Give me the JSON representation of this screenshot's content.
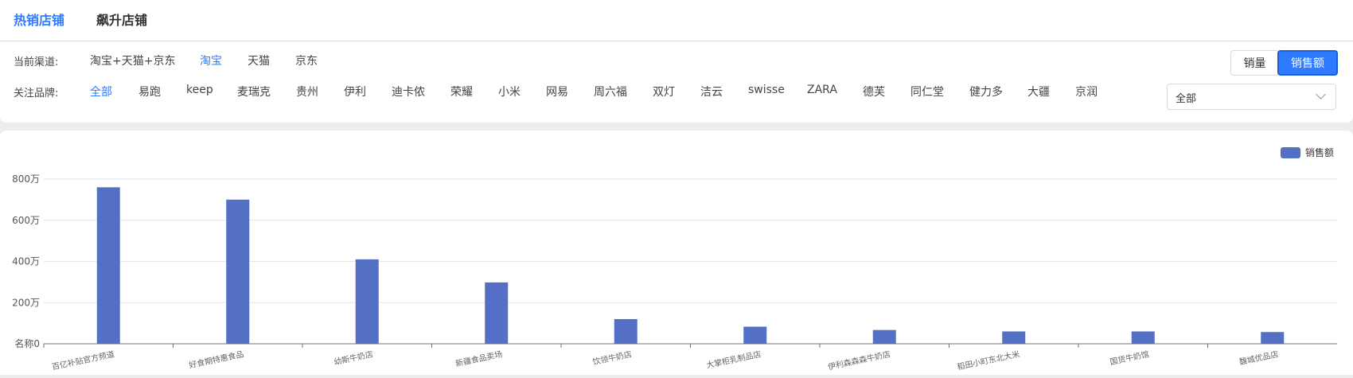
{
  "tabs": [
    {
      "label": "热销店铺",
      "active": true
    },
    {
      "label": "飙升店铺",
      "active": false
    }
  ],
  "channel": {
    "label": "当前渠道:",
    "options": [
      "淘宝+天猫+京东",
      "淘宝",
      "天猫",
      "京东"
    ],
    "selected": "淘宝"
  },
  "brand": {
    "label": "关注品牌:",
    "options": [
      "全部",
      "易跑",
      "keep",
      "麦瑞克",
      "贵州",
      "伊利",
      "迪卡侬",
      "荣耀",
      "小米",
      "网易",
      "周六福",
      "双灯",
      "洁云",
      "swisse",
      "ZARA",
      "德芙",
      "同仁堂",
      "健力多",
      "大疆",
      "京润"
    ],
    "selected": "全部"
  },
  "metric_toggle": {
    "options": [
      "销量",
      "销售额"
    ],
    "selected": "销售额"
  },
  "dropdown": {
    "value": "全部"
  },
  "colors": {
    "accent": "#2f7bff",
    "bar": "#5470c6"
  },
  "chart_data": {
    "type": "bar",
    "categories": [
      "百亿补贴官方频道",
      "好食期特惠食品",
      "幼斯牛奶店",
      "新疆食品卖场",
      "饮领牛奶店",
      "大掌柜乳制品店",
      "伊利森森森牛奶店",
      "稻田小町东北大米",
      "国货牛奶馆",
      "馥城优品店"
    ],
    "series": [
      {
        "name": "销售额",
        "values": [
          760,
          700,
          410,
          298,
          120,
          83,
          67,
          60,
          60,
          57
        ]
      }
    ],
    "ytick_labels": [
      "名称0",
      "200万",
      "400万",
      "600万",
      "800万"
    ],
    "ylim": [
      0,
      800
    ],
    "legend": "top-right",
    "grid": true
  }
}
